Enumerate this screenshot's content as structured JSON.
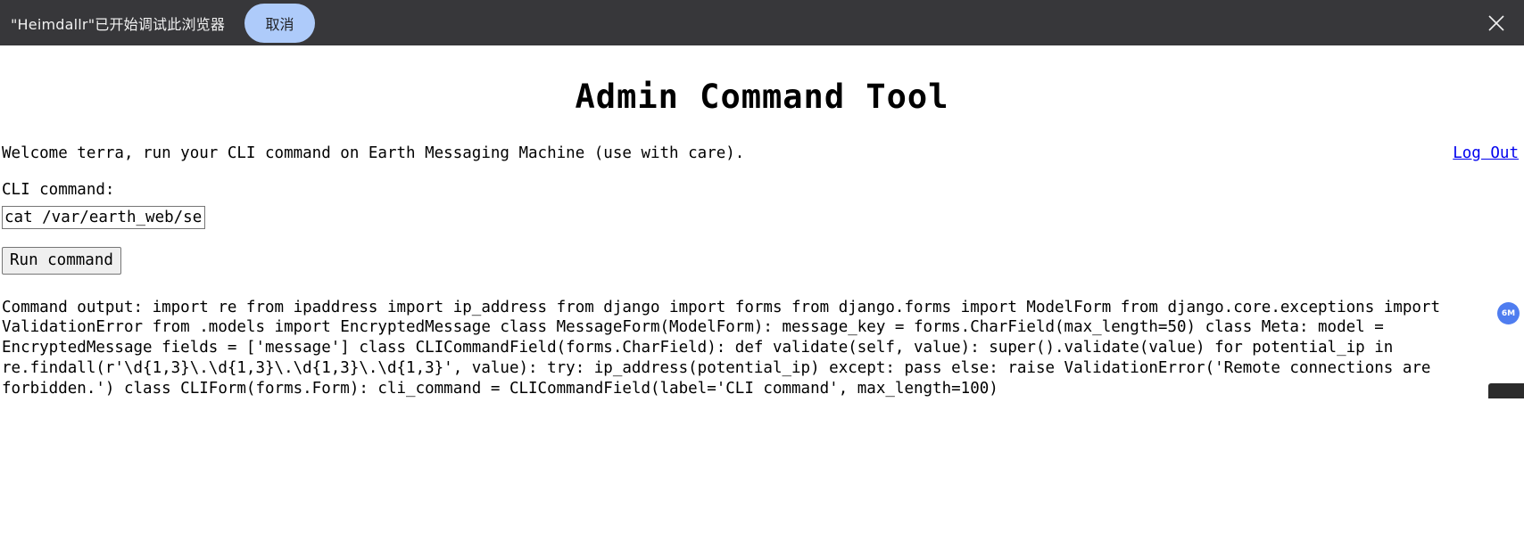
{
  "debug_banner": {
    "message": "\"Heimdallr\"已开始调试此浏览器",
    "cancel_label": "取消",
    "close_icon": "close-icon",
    "background_color": "#37373a",
    "cancel_button_color": "#aecbfa"
  },
  "page": {
    "title": "Admin Command Tool",
    "welcome_text": "Welcome terra, run your CLI command on Earth Messaging Machine (use with care).",
    "logout_label": "Log Out",
    "logout_color": "#0000ee",
    "cli_label": "CLI command:",
    "cli_value": "cat /var/earth_web/settings.py",
    "cli_placeholder": "",
    "run_button_label": "Run command",
    "command_output": "Command output: import re from ipaddress import ip_address from django import forms from django.forms import ModelForm from django.core.exceptions import ValidationError from .models import EncryptedMessage class MessageForm(ModelForm): message_key = forms.CharField(max_length=50) class Meta: model = EncryptedMessage fields = ['message'] class CLICommandField(forms.CharField): def validate(self, value): super().validate(value) for potential_ip in re.findall(r'\\d{1,3}\\.\\d{1,3}\\.\\d{1,3}\\.\\d{1,3}', value): try: ip_address(potential_ip) except: pass else: raise ValidationError('Remote connections are forbidden.') class CLIForm(forms.Form): cli_command = CLICommandField(label='CLI command', max_length=100)"
  },
  "overlays": {
    "badge_label": "6M",
    "badge_color": "#4f7df0"
  }
}
